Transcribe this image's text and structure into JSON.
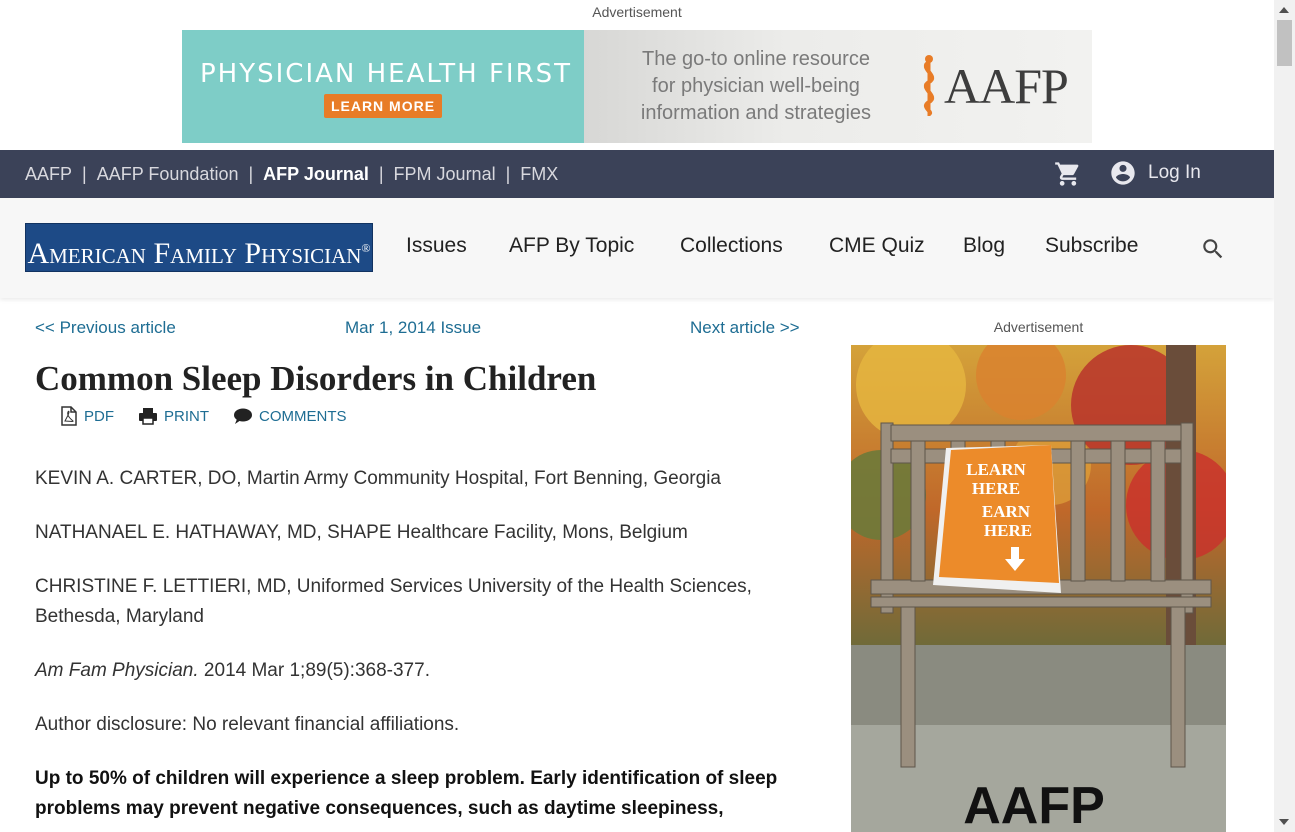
{
  "ads": {
    "top_label": "Advertisement",
    "side_label": "Advertisement",
    "banner": {
      "headline": "PHYSICIAN HEALTH FIRST",
      "cta": "LEARN MORE",
      "tagline_1": "The go-to online resource",
      "tagline_2": "for physician well-being",
      "tagline_3": "information and strategies",
      "brand": "AAFP"
    },
    "side": {
      "sign_1": "LEARN",
      "sign_2": "HERE",
      "sign_3": "EARN",
      "sign_4": "HERE",
      "brand": "AAFP"
    }
  },
  "topnav": {
    "links": [
      {
        "label": "AAFP"
      },
      {
        "label": "AAFP Foundation"
      },
      {
        "label": "AFP Journal"
      },
      {
        "label": "FPM Journal"
      },
      {
        "label": "FMX"
      }
    ],
    "separator": "|",
    "login": "Log In"
  },
  "mainnav": {
    "logo": "American Family Physician",
    "logo_mark": "®",
    "items": [
      "Issues",
      "AFP By Topic",
      "Collections",
      "CME Quiz",
      "Blog",
      "Subscribe"
    ]
  },
  "article_nav": {
    "prev": "<< Previous article",
    "issue": "Mar 1, 2014 Issue",
    "next": "Next article >>"
  },
  "article": {
    "title": "Common Sleep Disorders in Children",
    "tools": {
      "pdf": "PDF",
      "print": "PRINT",
      "comments": "COMMENTS"
    },
    "authors": [
      "KEVIN A. CARTER, DO, Martin Army Community Hospital, Fort Benning, Georgia",
      "NATHANAEL E. HATHAWAY, MD, SHAPE Healthcare Facility, Mons, Belgium",
      "CHRISTINE F. LETTIERI, MD, Uniformed Services University of the Health Sciences, Bethesda, Maryland"
    ],
    "citation_journal": "Am Fam Physician.",
    "citation_rest": " 2014 Mar 1;89(5):368-377.",
    "disclosure": "Author disclosure: No relevant financial affiliations.",
    "abstract": "Up to 50% of children will experience a sleep problem. Early identification of sleep problems may prevent negative consequences, such as daytime sleepiness,"
  },
  "colors": {
    "topnav_bg": "#3b4258",
    "link": "#1e6d93",
    "logo_bg": "#1d4a86",
    "banner_teal": "#7ecdc7",
    "banner_orange": "#e87c27"
  }
}
